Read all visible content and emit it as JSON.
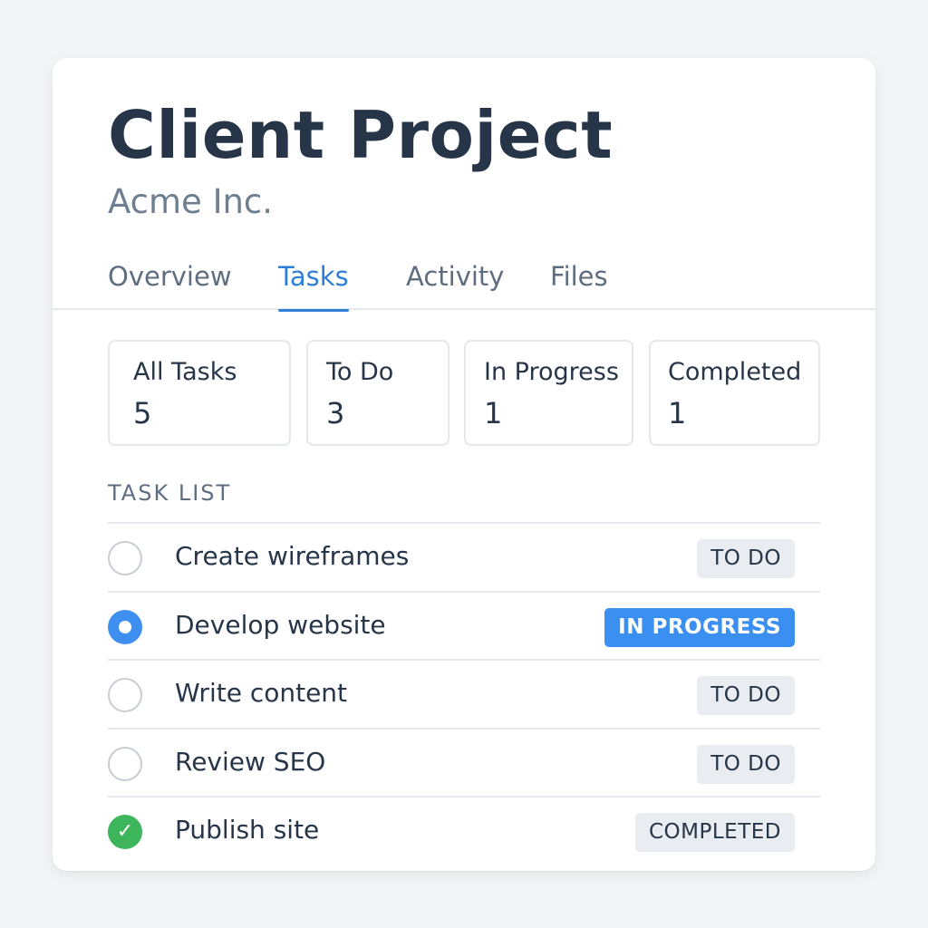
{
  "project": {
    "title": "Client Project",
    "client": "Acme Inc."
  },
  "tabs": [
    {
      "label": "Overview",
      "active": false
    },
    {
      "label": "Tasks",
      "active": true
    },
    {
      "label": "Activity",
      "active": false
    },
    {
      "label": "Files",
      "active": false
    }
  ],
  "stats": [
    {
      "label": "All Tasks",
      "count": "5"
    },
    {
      "label": "To Do",
      "count": "3"
    },
    {
      "label": "In Progress",
      "count": "1"
    },
    {
      "label": "Completed",
      "count": "1"
    }
  ],
  "task_list": {
    "heading": "TASK LIST",
    "tasks": [
      {
        "name": "Create wireframes",
        "status": "TO DO",
        "state": "todo",
        "check_icon": "empty-circle-icon"
      },
      {
        "name": "Develop website",
        "status": "IN PROGRESS",
        "state": "in-progress",
        "check_icon": "radio-dot-icon"
      },
      {
        "name": "Write content",
        "status": "TO DO",
        "state": "todo",
        "check_icon": "empty-circle-icon"
      },
      {
        "name": "Review SEO",
        "status": "TO DO",
        "state": "todo",
        "check_icon": "empty-circle-icon"
      },
      {
        "name": "Publish site",
        "status": "COMPLETED",
        "state": "completed",
        "check_icon": "checkmark-circle-icon"
      }
    ]
  },
  "colors": {
    "accent": "#2f7fd8",
    "in_progress": "#3a8ff0",
    "completed": "#3cb55b",
    "text": "#263548",
    "muted": "#6e7f91"
  }
}
